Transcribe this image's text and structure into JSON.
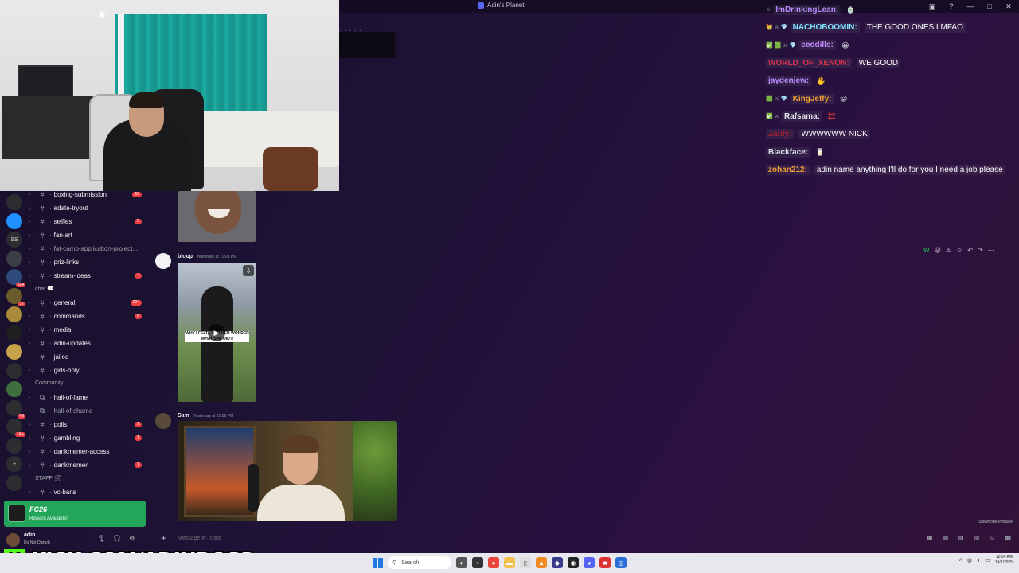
{
  "window": {
    "title": "Adin's Planet"
  },
  "server_rail": [
    {
      "label": "",
      "color": "#2b2d31",
      "badge": ""
    },
    {
      "label": "",
      "color": "#1e90ff",
      "badge": ""
    },
    {
      "label": "SS",
      "color": "#2b2d31",
      "badge": ""
    },
    {
      "label": "",
      "color": "#3b3d44",
      "badge": ""
    },
    {
      "label": "",
      "color": "#2d4a7a",
      "badge": "224"
    },
    {
      "label": "",
      "color": "#6b5a2a",
      "badge": "37"
    },
    {
      "label": "",
      "color": "#a88a3a",
      "badge": ""
    },
    {
      "label": "",
      "color": "#1f1f22",
      "badge": ""
    },
    {
      "label": "",
      "color": "#c8a24a",
      "badge": ""
    },
    {
      "label": "",
      "color": "#2b2d31",
      "badge": ""
    },
    {
      "label": "",
      "color": "#3f6f3f",
      "badge": ""
    },
    {
      "label": "",
      "color": "#2b2d31",
      "badge": "49"
    },
    {
      "label": "",
      "color": "#2b2d31",
      "badge": "1K+"
    },
    {
      "label": "",
      "color": "#2b2d31",
      "badge": ""
    },
    {
      "label": "+",
      "color": "#2b2d31",
      "badge": ""
    },
    {
      "label": "",
      "color": "#2b2d31",
      "badge": ""
    }
  ],
  "channels": {
    "top_group": [
      {
        "name": "boxing-submission",
        "badge": "16"
      },
      {
        "name": "edate-tryout",
        "badge": ""
      },
      {
        "name": "selfies",
        "badge": "3"
      },
      {
        "name": "fan-art",
        "badge": ""
      },
      {
        "name": "fat-camp-application-project...",
        "badge": "",
        "muted": true
      },
      {
        "name": "priz-links",
        "badge": ""
      },
      {
        "name": "stream-ideas",
        "badge": "4"
      }
    ],
    "chat_category": "chat 💬",
    "chat_group": [
      {
        "name": "general",
        "badge": "224"
      },
      {
        "name": "commands",
        "badge": "8"
      },
      {
        "name": "media",
        "badge": ""
      },
      {
        "name": "adin-updates",
        "badge": ""
      },
      {
        "name": "jailed",
        "badge": ""
      },
      {
        "name": "girls-only",
        "badge": ""
      }
    ],
    "community_category": "Community",
    "community_group": [
      {
        "name": "hall-of-fame",
        "badge": ""
      },
      {
        "name": "hall-of-shame",
        "badge": "",
        "muted": true
      },
      {
        "name": "polls",
        "badge": "1"
      },
      {
        "name": "gambling",
        "badge": "1"
      },
      {
        "name": "dankmemer-access",
        "badge": ""
      },
      {
        "name": "dankmemer",
        "badge": "1"
      }
    ],
    "staff_category": "STAFF 🛠",
    "staff_group": [
      {
        "name": "vc-bans",
        "badge": ""
      }
    ]
  },
  "reward": {
    "brand": "FC26",
    "subtitle": "Reward Available!"
  },
  "user": {
    "name": "adin",
    "status": "Do Not Disturb"
  },
  "kick": {
    "logo": "K",
    "url": "KICK.COM/ADINROSS"
  },
  "messages": [
    {
      "author": "bloop",
      "time": "Yesterday at 10:05 PM",
      "video_caption": "WHY I FELT... FOR HER WONDER WHAT SHE DID?!"
    },
    {
      "author": "Sam",
      "time": "Yesterday at 10:09 PM"
    }
  ],
  "hover_toolbar": [
    "W",
    "😃",
    "⚠",
    "☺",
    "↶",
    "↷",
    "⋯"
  ],
  "slowmode": "Slowmode Immune",
  "composer": {
    "placeholder": "Message # · clips"
  },
  "chat_overlay": [
    {
      "badges": "⚔",
      "user": "ImDrinkingLean:",
      "color": "#b98bff",
      "text": "",
      "emote": "🍵"
    },
    {
      "badges": "👑 ⚔ 💎",
      "user": "NACHOBOOMIN:",
      "color": "#7fe3ff",
      "text": "THE GOOD ONES LMFAO",
      "emote": ""
    },
    {
      "badges": "✅ 🟩 ⚔ 💎",
      "user": "ceodills:",
      "color": "#c48bff",
      "text": "",
      "emote": "😀"
    },
    {
      "badges": "",
      "user": "WORLD_OF_XENON:",
      "color": "#d8324f",
      "text": "WE GOOD",
      "emote": ""
    },
    {
      "badges": "",
      "user": "jaydenjew:",
      "color": "#b98bff",
      "text": "",
      "emote": "🖐"
    },
    {
      "badges": "🟩 ⚔ 💎",
      "user": "KingJeffy:",
      "color": "#f0a030",
      "text": "",
      "emote": "😀"
    },
    {
      "badges": "✅ ⚔",
      "user": "Rafsama:",
      "color": "#dfe3ea",
      "text": "",
      "emote": "💢"
    },
    {
      "badges": "",
      "user": "Zaidy:",
      "color": "#a0202a",
      "text": "WWWWWW NICK",
      "emote": ""
    },
    {
      "badges": "",
      "user": "Blackface:",
      "color": "#dfe3ea",
      "text": "",
      "emote": "🥛"
    },
    {
      "badges": "",
      "user": "zohan212:",
      "color": "#f0a030",
      "text": "adin name anything I'll do for you I need a job please",
      "emote": ""
    }
  ],
  "taskbar": {
    "search_label": "Search",
    "time": "12:04 AM",
    "date": "10/1/2025"
  },
  "colors": {
    "accent": "#5865f2",
    "kick_green": "#53fc18",
    "reward_green": "#23a55a",
    "badge_red": "#f23f43"
  }
}
